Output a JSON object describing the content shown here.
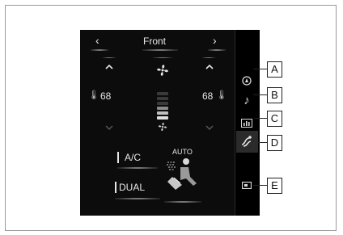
{
  "header": {
    "title": "Front",
    "left_arrow": "‹",
    "right_arrow": "›"
  },
  "temperature": {
    "left": "68",
    "right": "68"
  },
  "buttons": {
    "ac_label": "A/C",
    "dual_label": "DUAL",
    "auto_label": "AUTO"
  },
  "sidebar": {
    "icons": [
      "climate-icon",
      "music-note-icon",
      "equalizer-icon",
      "airflow-icon",
      "screen-off-icon"
    ],
    "selected": "airflow-icon"
  },
  "callouts": [
    "A",
    "B",
    "C",
    "D",
    "E"
  ],
  "fan_level": 0.35
}
